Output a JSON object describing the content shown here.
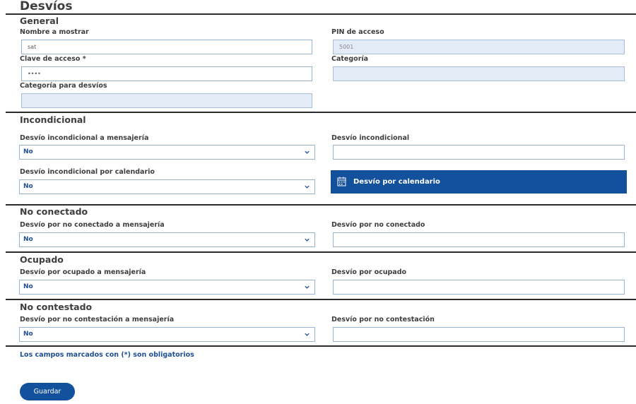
{
  "page": {
    "title": "Desvíos"
  },
  "general": {
    "title": "General",
    "display_name_label": "Nombre a mostrar",
    "display_name_value": "sat",
    "pin_label": "PIN de acceso",
    "pin_value": "5001",
    "password_label": "Clave de acceso *",
    "password_value": "••••",
    "category_label": "Categoría",
    "category_value": "",
    "forward_category_label": "Categoría para desvíos",
    "forward_category_value": ""
  },
  "unconditional": {
    "title": "Incondicional",
    "to_voicemail_label": "Desvío incondicional a mensajería",
    "to_voicemail_value": "No",
    "number_label": "Desvío incondicional",
    "number_value": "",
    "by_calendar_label": "Desvío incondicional por calendario",
    "by_calendar_value": "No",
    "calendar_button_label": "Desvío por calendario"
  },
  "not_connected": {
    "title": "No conectado",
    "to_voicemail_label": "Desvío por no conectado a mensajería",
    "to_voicemail_value": "No",
    "number_label": "Desvío por no conectado",
    "number_value": ""
  },
  "busy": {
    "title": "Ocupado",
    "to_voicemail_label": "Desvío por ocupado a mensajería",
    "to_voicemail_value": "No",
    "number_label": "Desvío por ocupado",
    "number_value": ""
  },
  "no_answer": {
    "title": "No contestado",
    "to_voicemail_label": "Desvío por no contestación a mensajería",
    "to_voicemail_value": "No",
    "number_label": "Desvío por no contestación",
    "number_value": ""
  },
  "footer": {
    "required_note": "Los campos marcados con (*) son obligatorios",
    "save_label": "Guardar"
  },
  "colors": {
    "accent": "#14519c",
    "link": "#1d4e94",
    "disabled_bg": "#e3ebf7",
    "border": "#97b3d0"
  },
  "icons": {
    "dropdown": "chevron-down-icon",
    "calendar": "calendar-icon"
  }
}
